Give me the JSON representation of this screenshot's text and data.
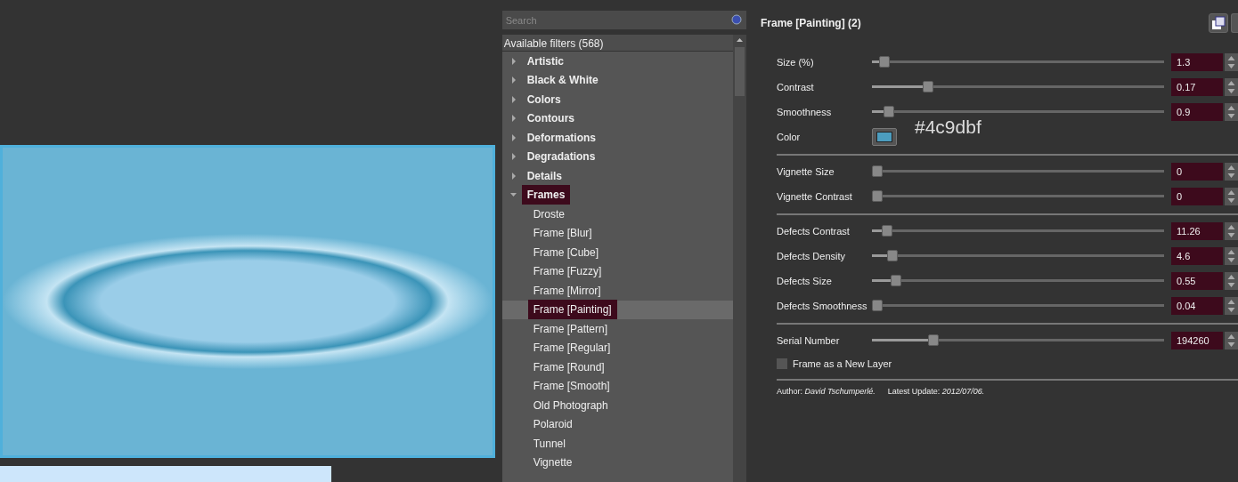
{
  "filters": {
    "search": {
      "placeholder": "Search"
    },
    "header": "Available filters (568)",
    "tree": [
      {
        "label": "Artistic",
        "expanded": false,
        "selected": false
      },
      {
        "label": "Black & White",
        "expanded": false,
        "selected": false
      },
      {
        "label": "Colors",
        "expanded": false,
        "selected": false
      },
      {
        "label": "Contours",
        "expanded": false,
        "selected": false
      },
      {
        "label": "Deformations",
        "expanded": false,
        "selected": false
      },
      {
        "label": "Degradations",
        "expanded": false,
        "selected": false
      },
      {
        "label": "Details",
        "expanded": false,
        "selected": false
      },
      {
        "label": "Frames",
        "expanded": true,
        "selected": true,
        "children": [
          {
            "label": "Droste",
            "selected": false
          },
          {
            "label": "Frame [Blur]",
            "selected": false
          },
          {
            "label": "Frame [Cube]",
            "selected": false
          },
          {
            "label": "Frame [Fuzzy]",
            "selected": false
          },
          {
            "label": "Frame [Mirror]",
            "selected": false
          },
          {
            "label": "Frame [Painting]",
            "selected": true
          },
          {
            "label": "Frame [Pattern]",
            "selected": false
          },
          {
            "label": "Frame [Regular]",
            "selected": false
          },
          {
            "label": "Frame [Round]",
            "selected": false
          },
          {
            "label": "Frame [Smooth]",
            "selected": false
          },
          {
            "label": "Old Photograph",
            "selected": false
          },
          {
            "label": "Polaroid",
            "selected": false
          },
          {
            "label": "Tunnel",
            "selected": false
          },
          {
            "label": "Vignette",
            "selected": false
          }
        ]
      }
    ]
  },
  "settings": {
    "title": "Frame [Painting] (2)",
    "groups": [
      [
        {
          "kind": "slider",
          "label": "Size (%)",
          "level": 0.025,
          "value": "1.3"
        },
        {
          "kind": "slider",
          "label": "Contrast",
          "level": 0.18,
          "value": "0.17"
        },
        {
          "kind": "slider",
          "label": "Smoothness",
          "level": 0.04,
          "value": "0.9"
        },
        {
          "kind": "color",
          "label": "Color",
          "color": "#4c9dbf",
          "note": "#4c9dbf"
        }
      ],
      [
        {
          "kind": "slider",
          "label": "Vignette Size",
          "level": 0,
          "value": "0"
        },
        {
          "kind": "slider",
          "label": "Vignette Contrast",
          "level": 0,
          "value": "0"
        }
      ],
      [
        {
          "kind": "slider",
          "label": "Defects Contrast",
          "level": 0.035,
          "value": "11.26"
        },
        {
          "kind": "slider",
          "label": "Defects Density",
          "level": 0.055,
          "value": "4.6"
        },
        {
          "kind": "slider",
          "label": "Defects Size",
          "level": 0.065,
          "value": "0.55"
        },
        {
          "kind": "slider",
          "label": "Defects Smoothness",
          "level": 0,
          "value": "0.04"
        }
      ],
      [
        {
          "kind": "slider",
          "label": "Serial Number",
          "level": 0.2,
          "value": "194260"
        },
        {
          "kind": "checkbox",
          "label": "Frame as a New Layer",
          "checked": false
        }
      ]
    ],
    "author": "Author: *David Tschumperlé.*",
    "update": "Latest Update: *2012/07/06.*"
  }
}
